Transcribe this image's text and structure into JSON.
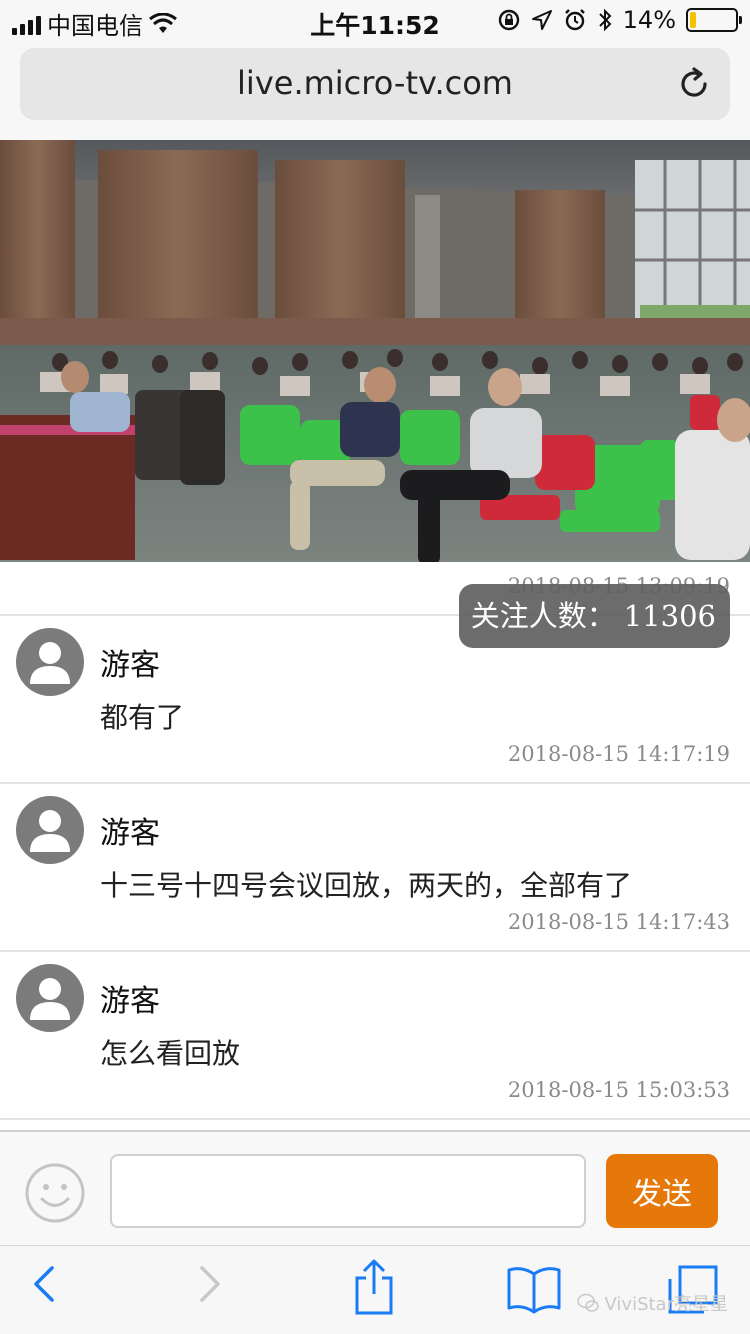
{
  "status_bar": {
    "carrier": "中国电信",
    "time": "上午11:52",
    "battery_text": "14%",
    "battery_level": 0.14
  },
  "browser": {
    "url": "live.micro-tv.com"
  },
  "video": {
    "first_timestamp": "2018-08-15 13:09:19",
    "follow_label": "关注人数：",
    "follow_count": "11306"
  },
  "comments": [
    {
      "name": "游客",
      "text": "都有了",
      "time": "2018-08-15 14:17:19"
    },
    {
      "name": "游客",
      "text": "十三号十四号会议回放，两天的，全部有了",
      "time": "2018-08-15 14:17:43"
    },
    {
      "name": "游客",
      "text": "怎么看回放",
      "time": "2018-08-15 15:03:53"
    }
  ],
  "input_bar": {
    "placeholder": "",
    "send_label": "发送"
  },
  "toolbar": {
    "watermark": "ViviStar亮星星"
  },
  "colors": {
    "send_button": "#e6780a",
    "badge_bg": "#5f5f5f",
    "battery_fill": "#f2c200"
  },
  "icons": [
    "signal-icon",
    "wifi-icon",
    "orientation-lock-icon",
    "location-icon",
    "alarm-icon",
    "bluetooth-icon",
    "battery-icon",
    "reload-icon",
    "avatar-icon",
    "emoji-icon",
    "back-icon",
    "forward-icon",
    "share-icon",
    "bookmarks-icon",
    "tabs-icon",
    "wechat-icon"
  ]
}
